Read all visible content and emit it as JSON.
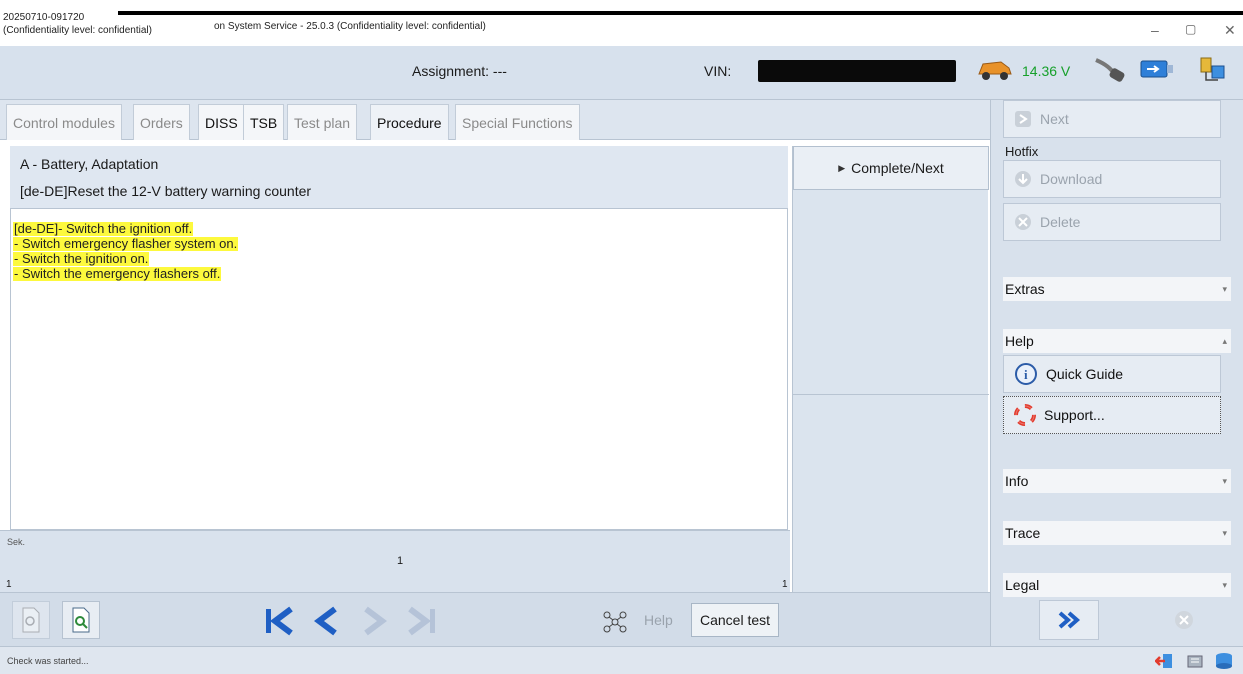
{
  "window": {
    "title_line1": "20250710-091720",
    "title_line2": "(Confidentiality level: confidential)",
    "title_line3": "on System Service - 25.0.3 (Confidentiality level: confidential)",
    "minimize": "–",
    "maximize": "▢",
    "close": "✕"
  },
  "header": {
    "assignment": "Assignment:  ---",
    "vin_label": "VIN:",
    "voltage": "14.36 V"
  },
  "tabs": [
    {
      "label": "Control modules",
      "state": "inactive"
    },
    {
      "label": "Orders",
      "state": "inactive"
    },
    {
      "label": "DISS",
      "state": "active"
    },
    {
      "label": "TSB",
      "state": "active"
    },
    {
      "label": "Test plan",
      "state": "inactive"
    },
    {
      "label": "Procedure",
      "state": "selected"
    },
    {
      "label": "Special Functions",
      "state": "inactive"
    }
  ],
  "procedure": {
    "line1": "A - Battery, Adaptation",
    "line2": "[de-DE]Reset the 12-V battery warning counter",
    "instructions": [
      "[de-DE]- Switch the ignition off.",
      "- Switch emergency flasher system on.",
      "- Switch the ignition on.",
      "- Switch the emergency flashers off."
    ]
  },
  "counter": {
    "sek_label": "Sek.",
    "center_value": "1",
    "left_value": "1",
    "right_value": "1"
  },
  "toolbar": {
    "help_label": "Help",
    "cancel_label": "Cancel test"
  },
  "middle": {
    "complete_label": "Complete/Next"
  },
  "right_panel": {
    "next_label": "Next",
    "hotfix_label": "Hotfix",
    "download_label": "Download",
    "delete_label": "Delete",
    "extras_label": "Extras",
    "help_label": "Help",
    "quick_guide_label": "Quick Guide",
    "support_label": "Support...",
    "info_label": "Info",
    "trace_label": "Trace",
    "legal_label": "Legal"
  },
  "status": {
    "text": "Check was started..."
  },
  "colors": {
    "highlight": "#fdf93d",
    "panel_bg": "#d8e1ec",
    "voltage_green": "#16a02a",
    "nav_blue": "#1f5fc4"
  }
}
